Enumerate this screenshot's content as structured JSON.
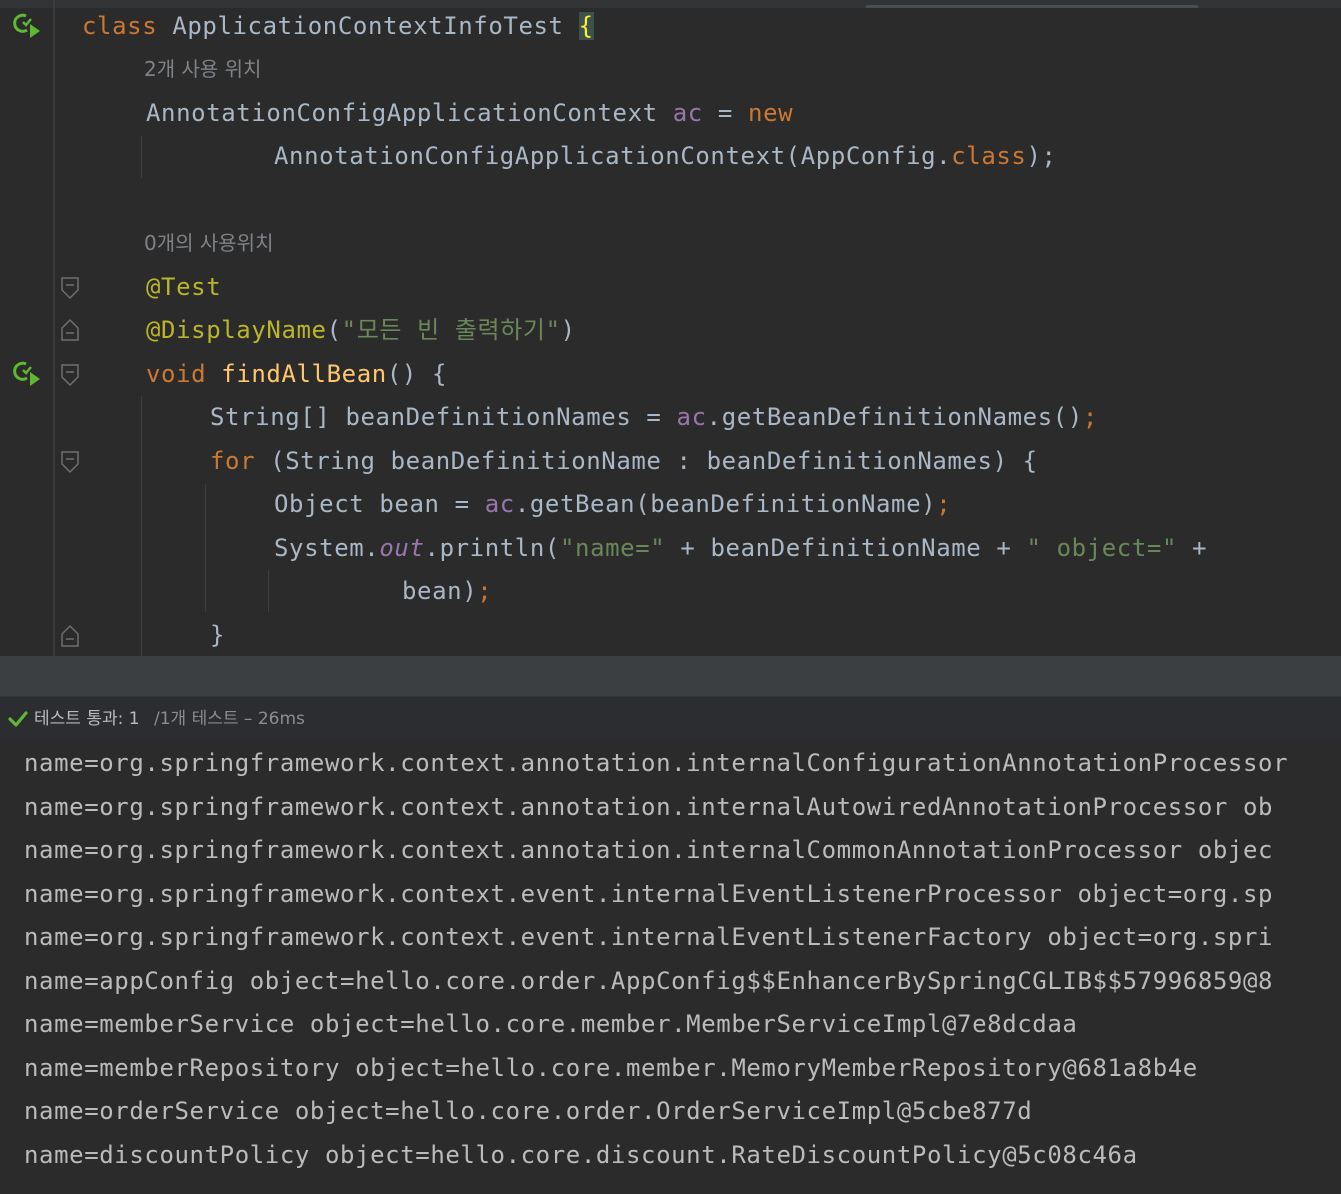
{
  "editor": {
    "class_decl": {
      "kw": "class",
      "name": "ApplicationContextInfoTest",
      "brace": "{"
    },
    "usage_hint_1": "2개 사용 위치",
    "field_line": {
      "type": "AnnotationConfigApplicationContext",
      "var": "ac",
      "op": "=",
      "kw": "new"
    },
    "field_cont": {
      "ctor": "AnnotationConfigApplicationContext(AppConfig.",
      "kw": "class",
      "end": ");"
    },
    "usage_hint_2": "0개의 사용위치",
    "ann_test": "@Test",
    "ann_display": {
      "name": "@DisplayName",
      "open": "(",
      "str": "\"모든 빈 출력하기\"",
      "close": ")"
    },
    "method_decl": {
      "kw": "void",
      "name": "findAllBean",
      "rest": "() {"
    },
    "stmt1": {
      "a": "String[] beanDefinitionNames = ",
      "fld": "ac",
      "b": ".getBeanDefinitionNames()",
      "semi": ";"
    },
    "stmt2": {
      "kw": "for",
      "rest": " (String beanDefinitionName : beanDefinitionNames) {"
    },
    "stmt3": {
      "a": "Object bean = ",
      "fld": "ac",
      "b": ".getBean(beanDefinitionName)",
      "semi": ";"
    },
    "stmt4": {
      "a": "System.",
      "out": "out",
      "b": ".println(",
      "s1": "\"name=\"",
      "c": " + beanDefinitionName + ",
      "s2": "\" object=\"",
      "d": " +"
    },
    "stmt4_cont": {
      "a": "bean)",
      "semi": ";"
    },
    "close_brace": "}"
  },
  "test_status": {
    "passed": "테스트 통과: 1",
    "total": "/1개 테스트 – 26ms"
  },
  "console": {
    "lines": [
      "name=org.springframework.context.annotation.internalConfigurationAnnotationProcessor",
      "name=org.springframework.context.annotation.internalAutowiredAnnotationProcessor ob",
      "name=org.springframework.context.annotation.internalCommonAnnotationProcessor objec",
      "name=org.springframework.context.event.internalEventListenerProcessor object=org.sp",
      "name=org.springframework.context.event.internalEventListenerFactory object=org.spri",
      "name=appConfig object=hello.core.order.AppConfig$$EnhancerBySpringCGLIB$$57996859@8",
      "name=memberService object=hello.core.member.MemberServiceImpl@7e8dcdaa",
      "name=memberRepository object=hello.core.member.MemoryMemberRepository@681a8b4e",
      "name=orderService object=hello.core.order.OrderServiceImpl@5cbe877d",
      "name=discountPolicy object=hello.core.discount.RateDiscountPolicy@5c08c46a"
    ]
  },
  "icons": {
    "run_gutter": "run-test-icon",
    "fold": "fold-icon",
    "passed": "checkmark-icon"
  },
  "colors": {
    "background": "#2b2b2b",
    "keyword": "#cc7832",
    "function": "#ffc66d",
    "annotation": "#bbb529",
    "string": "#6a8759",
    "field": "#9876aa",
    "default_text": "#a9b7c6",
    "passed_green": "#5fb832"
  }
}
